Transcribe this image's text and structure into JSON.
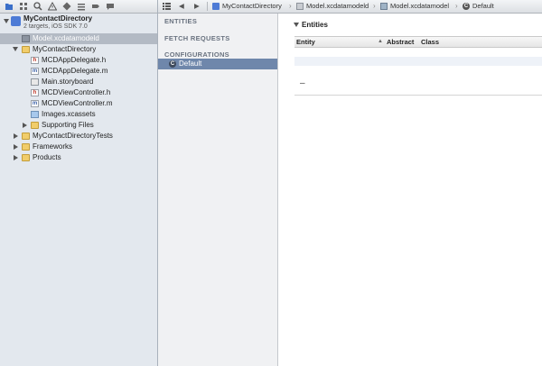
{
  "navigator": {
    "project": {
      "name": "MyContactDirectory",
      "subtitle": "2 targets, iOS SDK 7.0"
    },
    "items": [
      {
        "label": "Model.xcdatamodeld"
      },
      {
        "label": "MyContactDirectory"
      },
      {
        "label": "MCDAppDelegate.h"
      },
      {
        "label": "MCDAppDelegate.m"
      },
      {
        "label": "Main.storyboard"
      },
      {
        "label": "MCDViewController.h"
      },
      {
        "label": "MCDViewController.m"
      },
      {
        "label": "Images.xcassets"
      },
      {
        "label": "Supporting Files"
      },
      {
        "label": "MyContactDirectoryTests"
      },
      {
        "label": "Frameworks"
      },
      {
        "label": "Products"
      }
    ],
    "icon_letters": {
      "header": "h",
      "impl": "m"
    }
  },
  "jump_bar": {
    "crumbs": [
      "MyContactDirectory",
      "Model.xcdatamodeld",
      "Model.xcdatamodel",
      "Default"
    ],
    "nav_back": "◀",
    "nav_forward": "▶"
  },
  "model_sidebar": {
    "entities_header": "ENTITIES",
    "fetch_header": "FETCH REQUESTS",
    "config_header": "CONFIGURATIONS",
    "config_item": "Default",
    "config_icon_letter": "C"
  },
  "entities": {
    "title": "Entities",
    "columns": [
      "Entity",
      "Abstract",
      "Class"
    ],
    "add_remove": "–"
  },
  "colors": {
    "selection": "#b3bac4",
    "config_selection": "#6f87ab",
    "accent": "#3a6fc9"
  }
}
